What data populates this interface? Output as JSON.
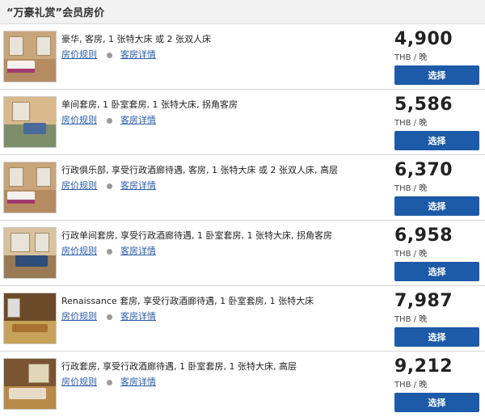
{
  "header": {
    "title": "“万豪礼赏”会员房价"
  },
  "links": {
    "rate_rules": "房价规则",
    "room_details": "客房详情"
  },
  "select_label": "选择",
  "rooms": [
    {
      "name": "豪华, 客房, 1 张特大床 或 2 张双人床",
      "price": "4,900",
      "unit": "THB / 晚"
    },
    {
      "name": "单间套房, 1 卧室套房, 1 张特大床, 拐角客房",
      "price": "5,586",
      "unit": "THB / 晚"
    },
    {
      "name": "行政俱乐部, 享受行政酒廊待遇, 客房, 1 张特大床 或 2 张双人床, 高层",
      "price": "6,370",
      "unit": "THB / 晚"
    },
    {
      "name": "行政单间套房, 享受行政酒廊待遇, 1 卧室套房, 1 张特大床, 拐角客房",
      "price": "6,958",
      "unit": "THB / 晚"
    },
    {
      "name": "Renaissance 套房, 享受行政酒廊待遇, 1 卧室套房, 1 张特大床",
      "price": "7,987",
      "unit": "THB / 晚"
    },
    {
      "name": "行政套房, 享受行政酒廊待遇, 1 卧室套房, 1 张特大床, 高层",
      "price": "9,212",
      "unit": "THB / 晚"
    }
  ]
}
